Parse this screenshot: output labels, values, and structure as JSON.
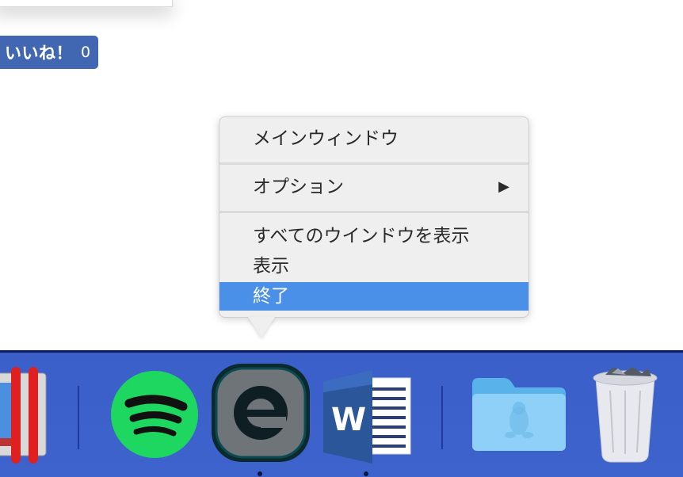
{
  "like": {
    "label": "いいね！",
    "count": "0"
  },
  "menu": {
    "items": [
      {
        "label": "メインウィンドウ"
      },
      {
        "label": "オプション",
        "arrow": "▶"
      },
      {
        "label": "すべてのウインドウを表示"
      },
      {
        "label": "表示"
      },
      {
        "label": "終了"
      }
    ],
    "selected_label": "終了",
    "highlight_color": "#4a90e8"
  },
  "dock": {
    "apps": [
      {
        "name": "parallels-icon"
      },
      {
        "name": "spotify-icon"
      },
      {
        "name": "eset-icon"
      },
      {
        "name": "word-icon",
        "glyph": "W"
      },
      {
        "name": "linux-folder-icon"
      },
      {
        "name": "trash-icon"
      }
    ],
    "background_color": "#3b5fc9"
  }
}
